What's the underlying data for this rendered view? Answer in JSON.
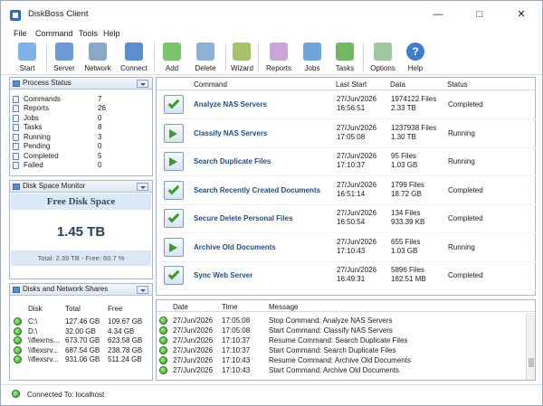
{
  "window": {
    "title": "DiskBoss Client"
  },
  "menu": [
    "File",
    "Command",
    "Tools",
    "Help"
  ],
  "toolbar": {
    "start": "Start",
    "server": "Server",
    "network": "Network",
    "connect": "Connect",
    "add": "Add",
    "delete": "Delete",
    "wizard": "Wizard",
    "reports": "Reports",
    "jobs": "Jobs",
    "tasks": "Tasks",
    "options": "Options",
    "help": "Help"
  },
  "process_status": {
    "title": "Process Status",
    "rows": [
      {
        "label": "Commands",
        "value": "7"
      },
      {
        "label": "Reports",
        "value": "26"
      },
      {
        "label": "Jobs",
        "value": "0"
      },
      {
        "label": "Tasks",
        "value": "8"
      },
      {
        "label": "Running",
        "value": "3"
      },
      {
        "label": "Pending",
        "value": "0"
      },
      {
        "label": "Completed",
        "value": "5"
      },
      {
        "label": "Failed",
        "value": "0"
      }
    ]
  },
  "disk_monitor": {
    "title": "Disk Space Monitor",
    "heading": "Free Disk Space",
    "value": "1.45 TB",
    "footer": "Total: 2.39 TB - Free: 60.7 %"
  },
  "disks": {
    "title": "Disks and Network Shares",
    "headers": [
      "Disk",
      "Total",
      "Free"
    ],
    "rows": [
      {
        "disk": "C:\\",
        "total": "127.46 GB",
        "free": "109.67 GB"
      },
      {
        "disk": "D:\\",
        "total": "32.00 GB",
        "free": "4.34 GB"
      },
      {
        "disk": "\\\\flexrns...",
        "total": "673.70 GB",
        "free": "623.58 GB"
      },
      {
        "disk": "\\\\flexsrv...",
        "total": "687.54 GB",
        "free": "238.78 GB"
      },
      {
        "disk": "\\\\flexsrv...",
        "total": "931.06 GB",
        "free": "511.24 GB"
      }
    ]
  },
  "commands": {
    "headers": [
      "Command",
      "Last Start",
      "Data",
      "Status"
    ],
    "rows": [
      {
        "name": "Analyze NAS Servers",
        "date": "27/Jun/2026",
        "time": "16:56:51",
        "files": "1974122 Files",
        "size": "2.33 TB",
        "status": "Completed",
        "icon": "check"
      },
      {
        "name": "Classify NAS Servers",
        "date": "27/Jun/2026",
        "time": "17:05:08",
        "files": "1237938 Files",
        "size": "1.30 TB",
        "status": "Running",
        "icon": "arrow"
      },
      {
        "name": "Search Duplicate Files",
        "date": "27/Jun/2026",
        "time": "17:10:37",
        "files": "95 Files",
        "size": "1.03 GB",
        "status": "Running",
        "icon": "arrow"
      },
      {
        "name": "Search Recently Created Documents",
        "date": "27/Jun/2026",
        "time": "16:51:14",
        "files": "1799 Files",
        "size": "18.72 GB",
        "status": "Completed",
        "icon": "check"
      },
      {
        "name": "Secure Delete Personal Files",
        "date": "27/Jun/2026",
        "time": "16:50:54",
        "files": "134 Files",
        "size": "933.39 KB",
        "status": "Completed",
        "icon": "check"
      },
      {
        "name": "Archive Old Documents",
        "date": "27/Jun/2026",
        "time": "17:10:43",
        "files": "655 Files",
        "size": "1.03 GB",
        "status": "Running",
        "icon": "arrow"
      },
      {
        "name": "Sync Web Server",
        "date": "27/Jun/2026",
        "time": "16:49:31",
        "files": "5896 Files",
        "size": "182.51 MB",
        "status": "Completed",
        "icon": "check"
      }
    ]
  },
  "log": {
    "headers": [
      "Date",
      "Time",
      "Message"
    ],
    "rows": [
      {
        "date": "27/Jun/2026",
        "time": "17:05:08",
        "message": "Stop Command: Analyze NAS Servers"
      },
      {
        "date": "27/Jun/2026",
        "time": "17:05:08",
        "message": "Start Command: Classify NAS Servers"
      },
      {
        "date": "27/Jun/2026",
        "time": "17:10:37",
        "message": "Resume Command: Search Duplicate Files"
      },
      {
        "date": "27/Jun/2026",
        "time": "17:10:37",
        "message": "Start Command: Search Duplicate Files"
      },
      {
        "date": "27/Jun/2026",
        "time": "17:10:43",
        "message": "Resume Command: Archive Old Documents"
      },
      {
        "date": "27/Jun/2026",
        "time": "17:10:43",
        "message": "Start Command: Archive Old Documents"
      }
    ]
  },
  "statusbar": {
    "text": "Connected To: localhost"
  }
}
